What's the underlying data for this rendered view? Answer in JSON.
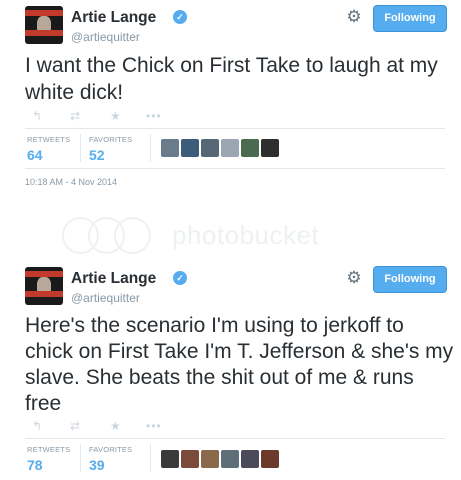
{
  "colors": {
    "accent": "#55acee",
    "text": "#292f33",
    "muted": "#8899a6",
    "icon_gray": "#ccd6dd",
    "divider": "#e1e8ed"
  },
  "icons": {
    "verified": "verified-badge-icon",
    "gear": "gear-icon",
    "reply": "reply-icon",
    "retweet": "retweet-icon",
    "favorite": "star-icon",
    "more": "more-dots-icon"
  },
  "watermark": {
    "text": "photobucket"
  },
  "tweets": [
    {
      "name": "Artie Lange",
      "handle": "@artiequitter",
      "follow_label": "Following",
      "text": "I want the Chick on First Take to laugh at my white dick!",
      "retweets_label": "RETWEETS",
      "retweets": "64",
      "favorites_label": "FAVORITES",
      "favorites": "52",
      "timestamp": "10:18 AM - 4 Nov 2014",
      "faver_colors": [
        "#6a7b8c",
        "#3d5c7a",
        "#556677",
        "#9aa7b2",
        "#4b6b4f",
        "#2e2e2e"
      ]
    },
    {
      "name": "Artie Lange",
      "handle": "@artiequitter",
      "follow_label": "Following",
      "text": "Here's the scenario I'm using to jerkoff to chick on First Take I'm T. Jefferson & she's my slave. She beats the shit out of me & runs free",
      "retweets_label": "RETWEETS",
      "retweets": "78",
      "favorites_label": "FAVORITES",
      "favorites": "39",
      "timestamp": "",
      "faver_colors": [
        "#3a3a3a",
        "#7a4a3a",
        "#8a6a4a",
        "#5f6f7a",
        "#4a4a5a",
        "#6b3a2a"
      ]
    }
  ]
}
